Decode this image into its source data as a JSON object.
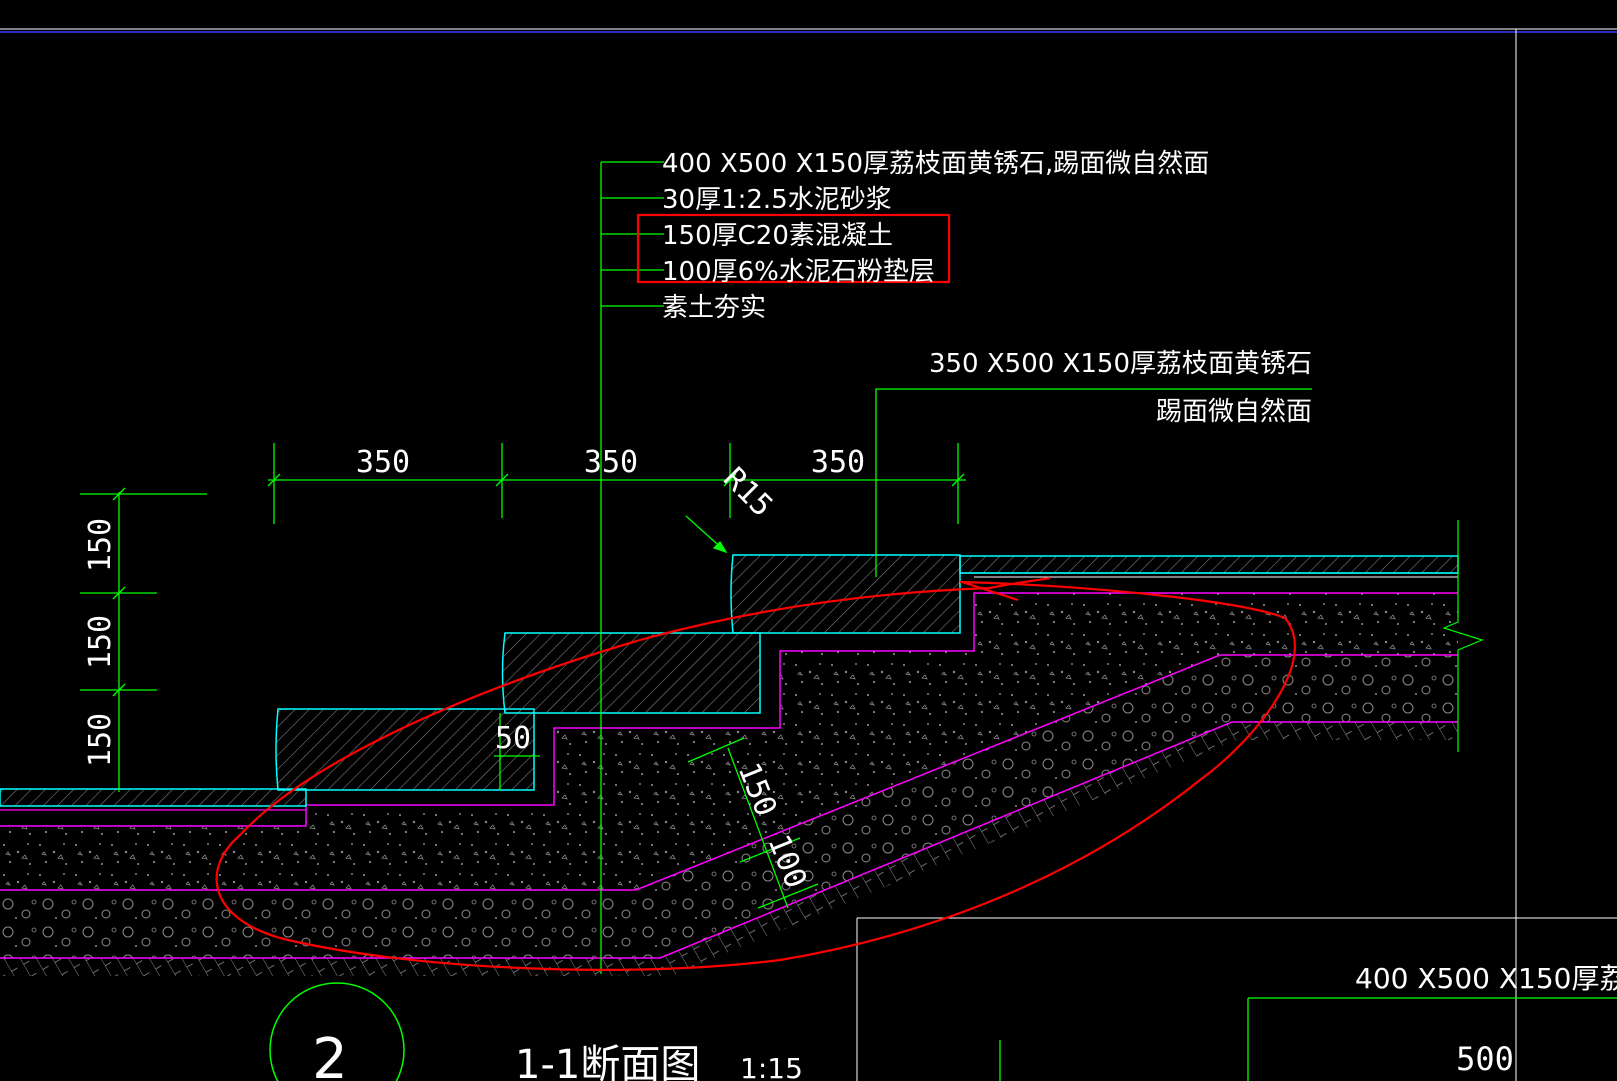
{
  "drawing": {
    "layer_labels": [
      "400 X500 X150厚荔枝面黄锈石,踢面微自然面",
      "30厚1:2.5水泥砂浆",
      "150厚C20素混凝土",
      "100厚6%水泥石粉垫层",
      "素土夯实"
    ],
    "step_stone_label_line1": "350 X500 X150厚荔枝面黄锈石",
    "step_stone_label_line2": "踢面微自然面",
    "dim_top": [
      "350",
      "350",
      "350"
    ],
    "dim_left": [
      "150",
      "150",
      "150"
    ],
    "radius_label": "R15",
    "dim_50": "50",
    "dim_slope_150": "150",
    "dim_slope_100": "100",
    "section_number": "2",
    "section_title": "1-1断面图",
    "section_scale": "1:15",
    "inset_label": "400 X500 X150厚荔",
    "inset_dim": "500",
    "colors": {
      "background": "#000000",
      "dimension": "#00ff00",
      "stone": "#00ffff",
      "layer_boundary": "#ff00ff",
      "highlight": "#ff0000",
      "text": "#ffffff",
      "frame": "#ffffff"
    }
  }
}
